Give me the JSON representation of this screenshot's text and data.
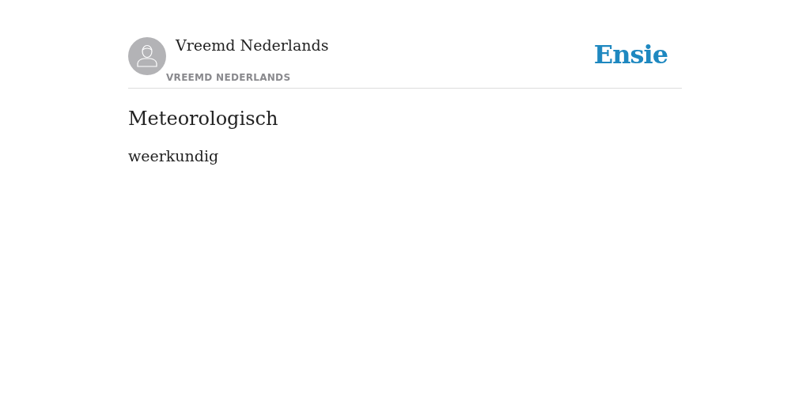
{
  "author": {
    "name": "Vreemd Nederlands",
    "source": "VREEMD NEDERLANDS"
  },
  "logo": "Ensie",
  "entry": {
    "title": "Meteorologisch",
    "definition": "weerkundig"
  }
}
